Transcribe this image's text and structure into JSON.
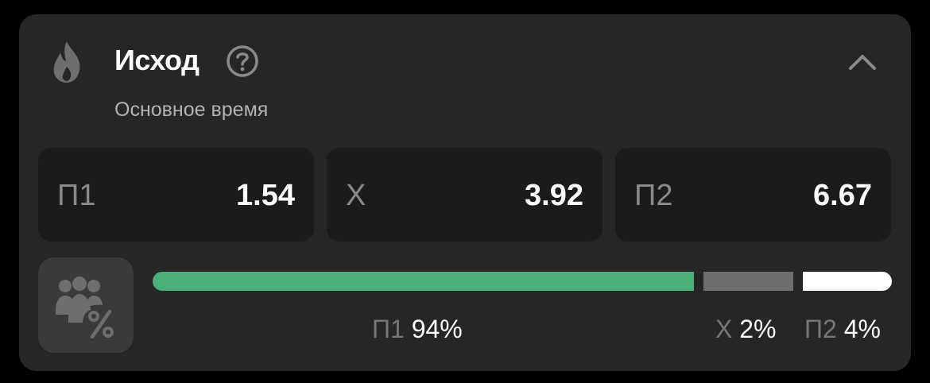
{
  "market": {
    "title": "Исход",
    "subtitle": "Основное время",
    "icon": "flame-icon",
    "help_icon": "question-circle-icon",
    "collapse_icon": "chevron-up-icon"
  },
  "odds": [
    {
      "label": "П1",
      "value": "1.54"
    },
    {
      "label": "Х",
      "value": "3.92"
    },
    {
      "label": "П2",
      "value": "6.67"
    }
  ],
  "bets_distribution": {
    "icon": "people-percent-icon",
    "items": [
      {
        "label": "П1",
        "percent_text": "94%",
        "percent": 94,
        "color": "#4caf7a"
      },
      {
        "label": "Х",
        "percent_text": "2%",
        "percent": 2,
        "color": "#6e6e6e"
      },
      {
        "label": "П2",
        "percent_text": "4%",
        "percent": 4,
        "color": "#ffffff"
      }
    ]
  },
  "colors": {
    "card_bg": "#262626",
    "tile_bg": "#1b1b1b",
    "accent": "#4caf7a"
  }
}
